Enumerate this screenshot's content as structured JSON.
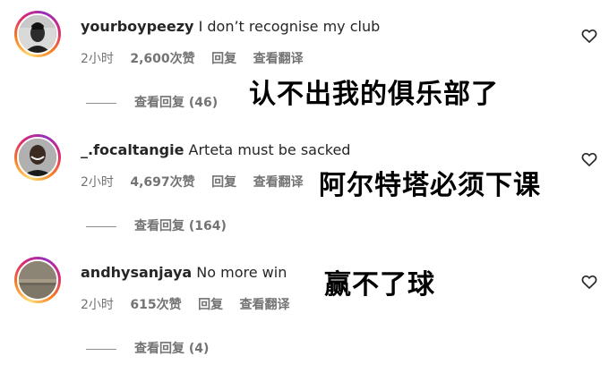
{
  "comments": [
    {
      "username": "yourboypeezy",
      "text": "I don’t recognise my club",
      "time": "2小时",
      "likes": "2,600次赞",
      "reply": "回复",
      "translate": "查看翻译",
      "view_replies": "查看回复 (46)",
      "caption": "认不出我的俱乐部了"
    },
    {
      "username": "_.focaltangie",
      "text": "Arteta must be sacked",
      "time": "2小时",
      "likes": "4,697次赞",
      "reply": "回复",
      "translate": "查看翻译",
      "view_replies": "查看回复 (164)",
      "caption": "阿尔特塔必须下课"
    },
    {
      "username": "andhysanjaya",
      "text": "No more win",
      "time": "2小时",
      "likes": "615次赞",
      "reply": "回复",
      "translate": "查看翻译",
      "view_replies": "查看回复 (4)",
      "caption": "赢不了球"
    }
  ],
  "icons": {
    "like": "heart-outline-icon"
  }
}
